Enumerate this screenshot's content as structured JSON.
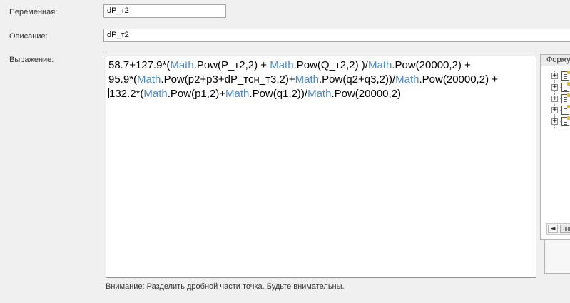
{
  "form": {
    "variable": {
      "label": "Переменная:",
      "value": "dP_т2"
    },
    "description": {
      "label": "Описание:",
      "value": "dP_т2"
    },
    "expression": {
      "label": "Выражение:",
      "lines": [
        [
          {
            "t": "58.7+127.9*(",
            "k": "n"
          },
          {
            "t": "Math",
            "k": "m"
          },
          {
            "t": ".",
            "k": "n"
          },
          {
            "t": "Pow(P_т2,2) + ",
            "k": "n"
          },
          {
            "t": "Math",
            "k": "m"
          },
          {
            "t": ".",
            "k": "n"
          },
          {
            "t": "Pow(Q_т2,2) )/",
            "k": "n"
          },
          {
            "t": "Math",
            "k": "m"
          },
          {
            "t": ".",
            "k": "n"
          },
          {
            "t": "Pow(20000,2) +",
            "k": "n"
          }
        ],
        [
          {
            "t": "95.9*(",
            "k": "n"
          },
          {
            "t": "Math",
            "k": "m"
          },
          {
            "t": ".",
            "k": "n"
          },
          {
            "t": "Pow(p2+p3+dP_тсн_т3,2)+",
            "k": "n"
          },
          {
            "t": "Math",
            "k": "m"
          },
          {
            "t": ".",
            "k": "n"
          },
          {
            "t": "Pow(q2+q3,2))/",
            "k": "n"
          },
          {
            "t": "Math",
            "k": "m"
          },
          {
            "t": ".",
            "k": "n"
          },
          {
            "t": "Pow(20000,2) +",
            "k": "n"
          }
        ],
        [
          {
            "t": "132.2*(",
            "k": "n"
          },
          {
            "t": "Math",
            "k": "m"
          },
          {
            "t": ".",
            "k": "n"
          },
          {
            "t": "Pow(p1,2)+",
            "k": "n"
          },
          {
            "t": "Math",
            "k": "m"
          },
          {
            "t": ".",
            "k": "n"
          },
          {
            "t": "Pow(q1,2))/",
            "k": "n"
          },
          {
            "t": "Math",
            "k": "m"
          },
          {
            "t": ".",
            "k": "n"
          },
          {
            "t": "Pow(20000,2)",
            "k": "n"
          }
        ]
      ]
    },
    "note": "Внимание: Разделить дробной части точка. Будьте внимательны."
  },
  "formula_panel": {
    "header": "Форму",
    "items_count": 5,
    "expander_symbol": "+",
    "scroll_left_symbol": "◄"
  },
  "colors": {
    "math_keyword": "#4d8ac4",
    "background": "#f0f0f0"
  }
}
